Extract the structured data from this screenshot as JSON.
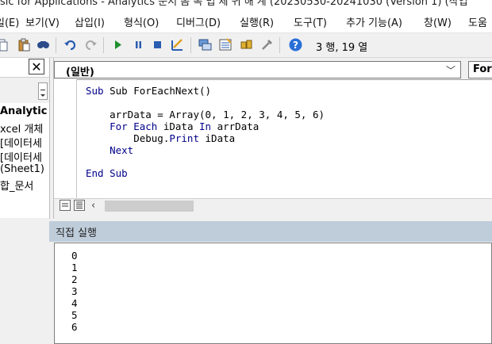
{
  "window": {
    "title_fragment": "sic for Applications - Analytics 문서 몸 독 법 제 귀 해 계 (20230530-20241030 (Version 1) (작업"
  },
  "menu": [
    {
      "label": "일(E)"
    },
    {
      "label": "보기(V)"
    },
    {
      "label": "삽입(I)"
    },
    {
      "label": "형식(O)"
    },
    {
      "label": "디버그(D)"
    },
    {
      "label": "실행(R)"
    },
    {
      "label": "도구(T)"
    },
    {
      "label": "추가 기능(A)"
    },
    {
      "label": "창(W)"
    },
    {
      "label": "도움"
    }
  ],
  "toolbar": {
    "position": "3 행, 19 열"
  },
  "project": {
    "items": [
      {
        "label": "Analytic",
        "bold": true
      },
      {
        "label": "xcel 개체"
      },
      {
        "label": "[데이터세"
      },
      {
        "label": "[데이터세"
      },
      {
        "label": "(Sheet1)"
      },
      {
        "label": "합_문서"
      }
    ]
  },
  "code_window": {
    "object_combo": "(일반)",
    "procedure_combo": "For",
    "lines": [
      "Sub ForEachNext()",
      "",
      "    arrData = Array(0, 1, 2, 3, 4, 5, 6)",
      "    For Each iData In arrData",
      "        Debug.Print iData",
      "    Next",
      "",
      "End Sub"
    ]
  },
  "immediate": {
    "title": "직접 실행",
    "output": [
      "0",
      "1",
      "2",
      "3",
      "4",
      "5",
      "6"
    ]
  },
  "colors": {
    "keyword": "#00008b",
    "immediate_title_bg": "#bfcddb"
  }
}
